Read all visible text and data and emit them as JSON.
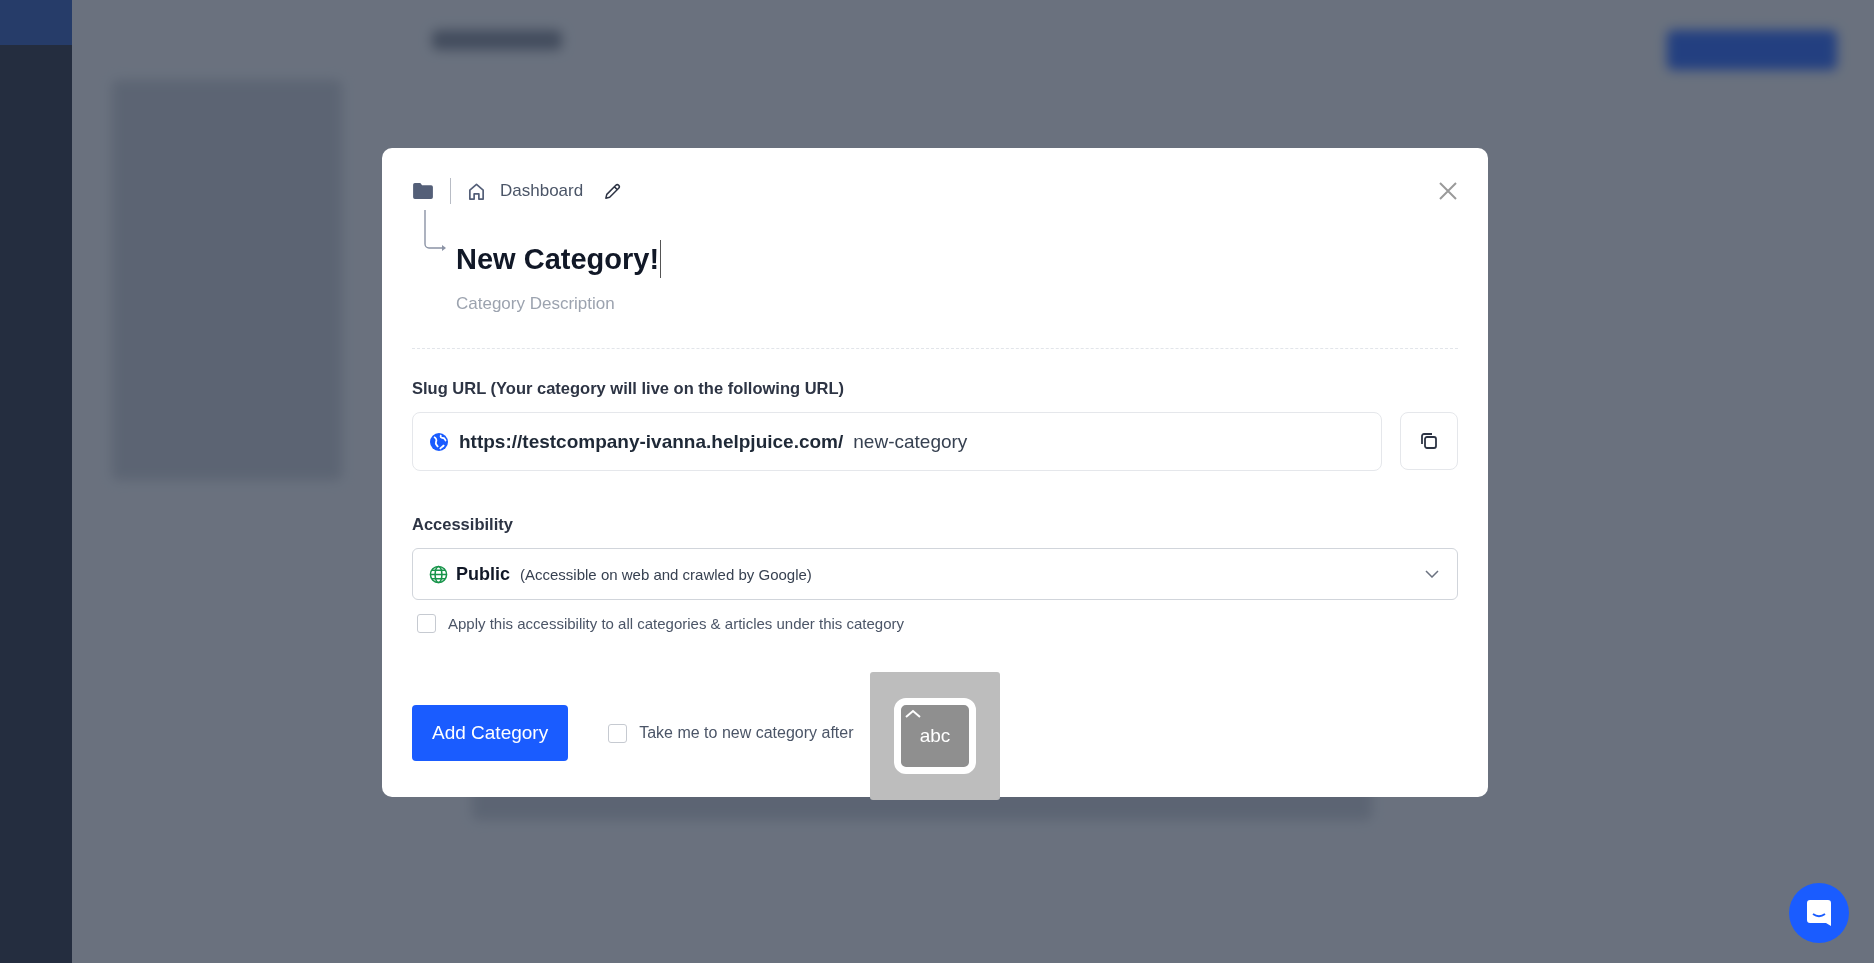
{
  "dialog": {
    "breadcrumb": {
      "label": "Dashboard"
    },
    "title": "New Category!",
    "description": {
      "placeholder": "Category Description"
    },
    "slug": {
      "label": "Slug URL (Your category will live on the following URL)",
      "base": "https://testcompany-ivanna.helpjuice.com/",
      "value": "new-category"
    },
    "accessibility": {
      "label": "Accessibility",
      "value": "Public",
      "hint": "(Accessible on web and crawled by Google)"
    },
    "apply_all": {
      "label": "Apply this accessibility to all categories & articles under this category",
      "checked": false
    },
    "submit": "Add Category",
    "redirect": {
      "label": "Take me to new category after",
      "checked": false
    }
  },
  "input_indicator": {
    "label": "abc"
  }
}
